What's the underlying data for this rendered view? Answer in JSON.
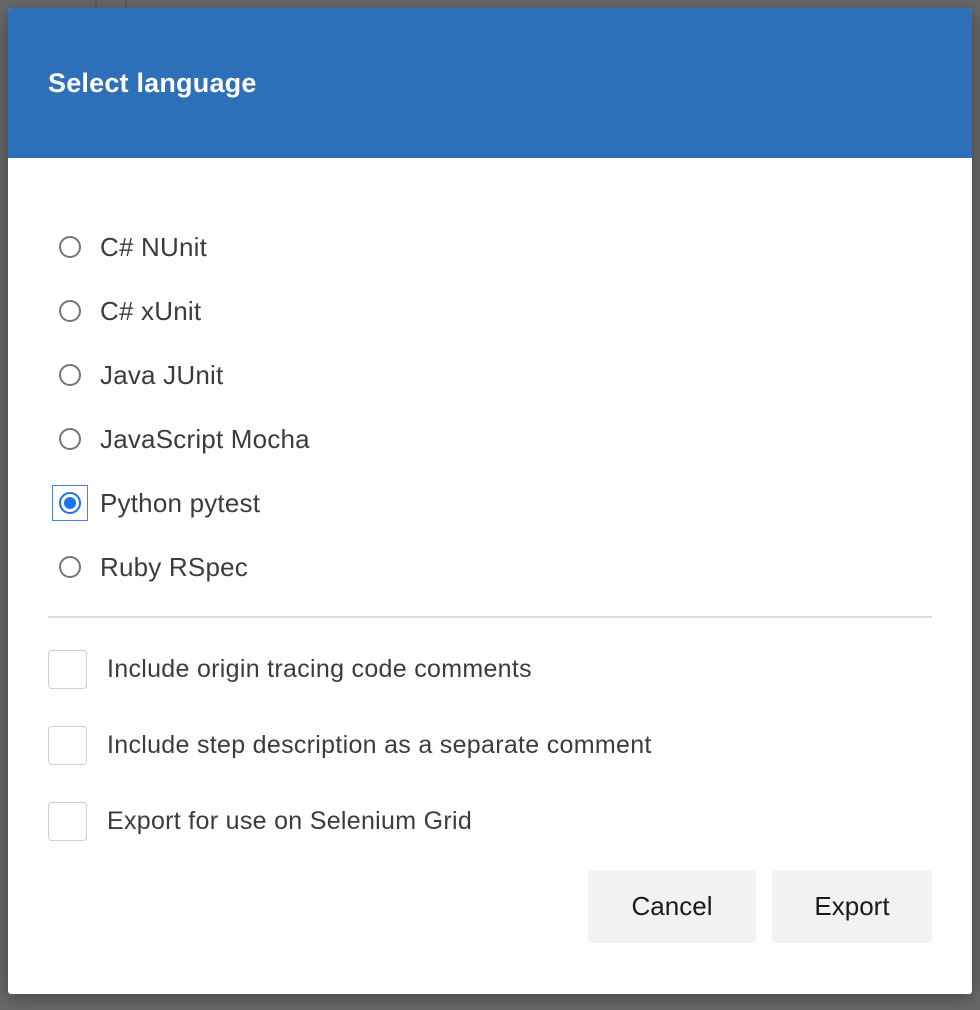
{
  "dialog": {
    "title": "Select language",
    "header_color": "#2e6fb9"
  },
  "languages": [
    {
      "label": "C# NUnit",
      "checked": false
    },
    {
      "label": "C# xUnit",
      "checked": false
    },
    {
      "label": "Java JUnit",
      "checked": false
    },
    {
      "label": "JavaScript Mocha",
      "checked": false
    },
    {
      "label": "Python pytest",
      "checked": true
    },
    {
      "label": "Ruby RSpec",
      "checked": false
    }
  ],
  "options": [
    {
      "label": "Include origin tracing code comments",
      "checked": false
    },
    {
      "label": "Include step description as a separate comment",
      "checked": false
    },
    {
      "label": "Export for use on Selenium Grid",
      "checked": false
    }
  ],
  "buttons": {
    "cancel_label": "Cancel",
    "export_label": "Export"
  },
  "colors": {
    "accent": "#1a73e8"
  }
}
